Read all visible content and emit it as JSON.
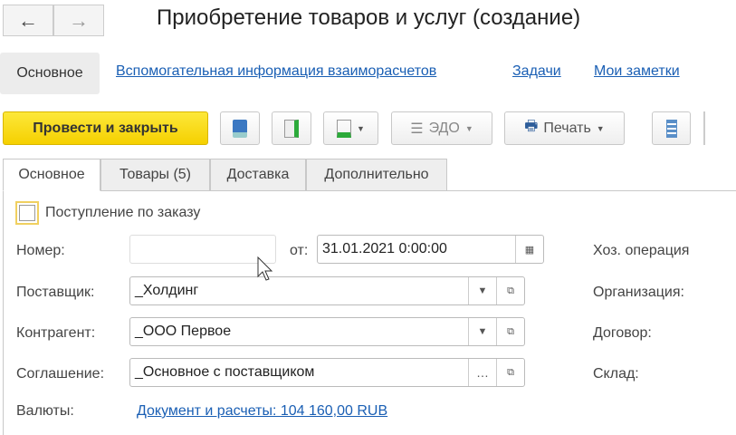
{
  "header": {
    "title": "Приобретение товаров и услуг (создание)",
    "back_icon": "←",
    "forward_icon": "→"
  },
  "nav": {
    "items": [
      "Основное",
      "Вспомогательная информация взаиморасчетов",
      "Задачи",
      "Мои заметки"
    ]
  },
  "toolbar": {
    "post_close": "Провести и закрыть",
    "edo": "ЭДО",
    "print": "Печать"
  },
  "tabs": [
    "Основное",
    "Товары (5)",
    "Доставка",
    "Дополнительно"
  ],
  "form": {
    "by_order": "Поступление по заказу",
    "number_label": "Номер:",
    "number_value": "",
    "date_label": "от:",
    "date_value": "31.01.2021  0:00:00",
    "supplier_label": "Поставщик:",
    "supplier_value": "_Холдинг",
    "counterparty_label": "Контрагент:",
    "counterparty_value": "_ООО Первое",
    "agreement_label": "Соглашение:",
    "agreement_value": "_Основное с поставщиком",
    "currency_label": "Валюты:",
    "currency_link": "Документ и расчеты: 104 160,00 RUB",
    "right_labels": [
      "Хоз. операция",
      "Организация:",
      "Договор:",
      "Склад:"
    ]
  }
}
